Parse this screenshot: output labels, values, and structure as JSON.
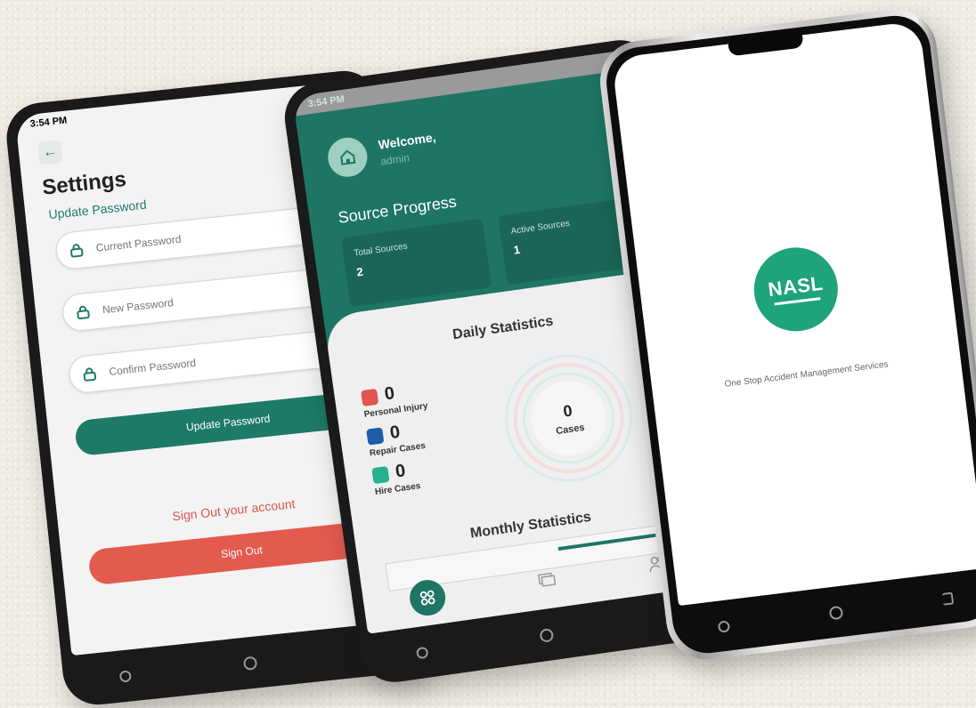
{
  "settings_screen": {
    "status_time": "3:54 PM",
    "title": "Settings",
    "section_label": "Update Password",
    "fields": [
      {
        "placeholder": "Current Password"
      },
      {
        "placeholder": "New Password"
      },
      {
        "placeholder": "Confirm Password"
      }
    ],
    "update_button": "Update Password",
    "signout_prompt": "Sign Out your account",
    "signout_button": "Sign Out",
    "colors": {
      "primary": "#1d7a68",
      "danger": "#e35a4f"
    }
  },
  "dashboard_screen": {
    "status_time": "3:54 PM",
    "welcome": "Welcome,",
    "username": "admin",
    "source_progress_title": "Source Progress",
    "cards": [
      {
        "label": "Total Sources",
        "value": "2"
      },
      {
        "label": "Active Sources",
        "value": "1"
      }
    ],
    "daily_title": "Daily Statistics",
    "legend": [
      {
        "value": "0",
        "label": "Personal Injury",
        "color": "#e05550"
      },
      {
        "value": "0",
        "label": "Repair Cases",
        "color": "#1d5ca8"
      },
      {
        "value": "0",
        "label": "Hire Cases",
        "color": "#25b08f"
      }
    ],
    "donut_value": "0",
    "donut_label": "Cases",
    "monthly_title": "Monthly Statistics",
    "colors": {
      "primary": "#1e7565"
    }
  },
  "splash_screen": {
    "logo_text": "NASL",
    "tagline": "One Stop Accident Management Services",
    "colors": {
      "logo": "#1ea37a"
    }
  }
}
